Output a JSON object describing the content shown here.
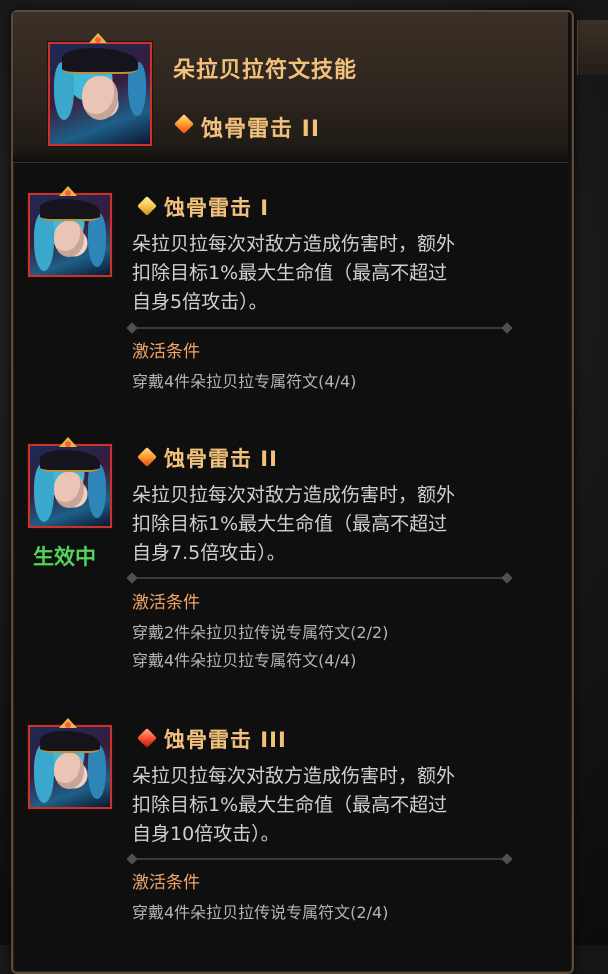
{
  "header": {
    "title": "朵拉贝拉符文技能",
    "current_skill": "蚀骨雷击 II",
    "gem_icon": "orange-diamond-icon"
  },
  "skills": [
    {
      "name": "蚀骨雷击 I",
      "gem_icon": "gold-diamond-icon",
      "desc_lines": [
        "朵拉贝拉每次对敌方造成伤害时，额外",
        "扣除目标1%最大生命值（最高不超过",
        "自身5倍攻击）。"
      ],
      "condition_label": "激活条件",
      "conditions": [
        "穿戴4件朵拉贝拉专属符文(4/4)"
      ],
      "active": false
    },
    {
      "name": "蚀骨雷击 II",
      "gem_icon": "orange-diamond-icon",
      "desc_lines": [
        "朵拉贝拉每次对敌方造成伤害时，额外",
        "扣除目标1%最大生命值（最高不超过",
        "自身7.5倍攻击）。"
      ],
      "condition_label": "激活条件",
      "conditions": [
        "穿戴2件朵拉贝拉传说专属符文(2/2)",
        "穿戴4件朵拉贝拉专属符文(4/4)"
      ],
      "active": true,
      "active_label": "生效中"
    },
    {
      "name": "蚀骨雷击 III",
      "gem_icon": "red-diamond-icon",
      "desc_lines": [
        "朵拉贝拉每次对敌方造成伤害时，额外",
        "扣除目标1%最大生命值（最高不超过",
        "自身10倍攻击）。"
      ],
      "condition_label": "激活条件",
      "conditions": [
        "穿戴4件朵拉贝拉传说专属符文(2/4)"
      ],
      "active": false
    }
  ],
  "colors": {
    "title": "#f2c27c",
    "condition_label": "#f0a66a",
    "active": "#52d65a"
  }
}
